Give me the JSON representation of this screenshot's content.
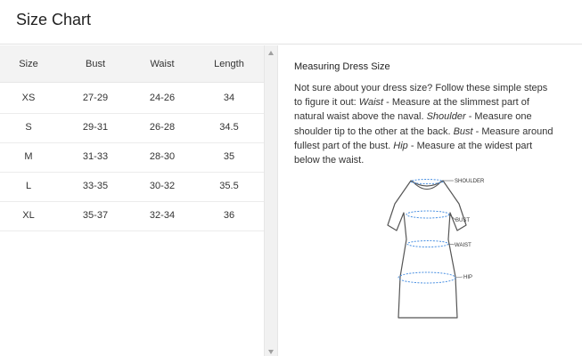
{
  "header": {
    "title": "Size Chart"
  },
  "table": {
    "columns": [
      "Size",
      "Bust",
      "Waist",
      "Length"
    ],
    "rows": [
      [
        "XS",
        "27-29",
        "24-26",
        "34"
      ],
      [
        "S",
        "29-31",
        "26-28",
        "34.5"
      ],
      [
        "M",
        "31-33",
        "28-30",
        "35"
      ],
      [
        "L",
        "33-35",
        "30-32",
        "35.5"
      ],
      [
        "XL",
        "35-37",
        "32-34",
        "36"
      ]
    ]
  },
  "guide": {
    "title": "Measuring Dress Size",
    "intro": "Not sure about your dress size? Follow these simple steps to figure it out: ",
    "steps": [
      {
        "name": "Waist",
        "text": " - Measure at the slimmest part of natural waist above the naval. "
      },
      {
        "name": "Shoulder",
        "text": " - Measure one shoulder tip to the other at the back. "
      },
      {
        "name": "Bust",
        "text": " - Measure around fullest part of the bust. "
      },
      {
        "name": "Hip",
        "text": " - Measure at the widest part below the waist."
      }
    ],
    "diagram_labels": {
      "shoulder": "SHOULDER",
      "bust": "BUST",
      "waist": "WAIST",
      "hip": "HIP"
    }
  },
  "colors": {
    "measure_line": "#4a90e2",
    "header_bg": "#f3f3f3"
  }
}
